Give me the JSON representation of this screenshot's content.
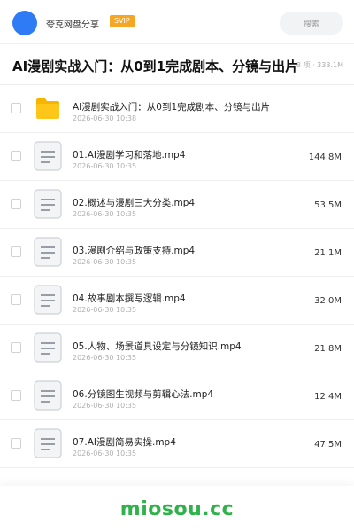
{
  "header": {
    "app_name": "夸克网盘分享",
    "badge": "SVIP",
    "search_placeholder": "搜索",
    "avatar_color": "#2f7bf5"
  },
  "folder": {
    "title": "AI漫剧实战入门：从0到1完成剧本、分镜与出片",
    "meta": "8 项 · 333.1M"
  },
  "rows": [
    {
      "icon": "folder-icon",
      "name": "AI漫剧实战入门：从0到1完成剧本、分镜与出片",
      "date": "2026-06-30 10:38",
      "size": ""
    },
    {
      "icon": "file-icon",
      "name": "01.AI漫剧学习和落地.mp4",
      "date": "2026-06-30 10:35",
      "size": "144.8M"
    },
    {
      "icon": "file-icon",
      "name": "02.概述与漫剧三大分类.mp4",
      "date": "2026-06-30 10:35",
      "size": "53.5M"
    },
    {
      "icon": "file-icon",
      "name": "03.漫剧介绍与政策支持.mp4",
      "date": "2026-06-30 10:35",
      "size": "21.1M"
    },
    {
      "icon": "file-icon",
      "name": "04.故事剧本撰写逻辑.mp4",
      "date": "2026-06-30 10:35",
      "size": "32.0M"
    },
    {
      "icon": "file-icon",
      "name": "05.人物、场景道具设定与分镜知识.mp4",
      "date": "2026-06-30 10:35",
      "size": "21.8M"
    },
    {
      "icon": "file-icon",
      "name": "06.分镜图生视频与剪辑心法.mp4",
      "date": "2026-06-30 10:35",
      "size": "12.4M"
    },
    {
      "icon": "file-icon",
      "name": "07.AI漫剧简易实操.mp4",
      "date": "2026-06-30 10:35",
      "size": "47.5M"
    }
  ],
  "footer": {
    "watermark": "miosou.cc",
    "watermark_color": "#2fb24a"
  }
}
